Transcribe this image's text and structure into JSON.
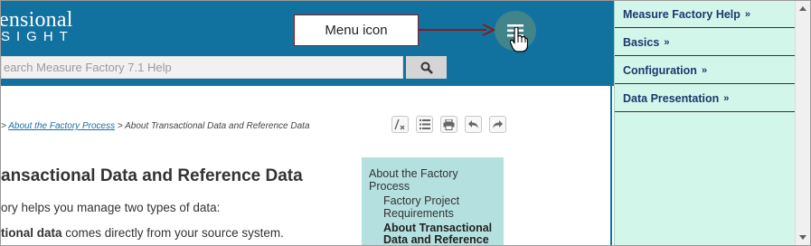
{
  "header": {
    "logo_main": "ensional",
    "logo_sub": "SIGHT",
    "search_placeholder": "earch Measure Factory 7.1 Help"
  },
  "callout": {
    "label": "Menu icon"
  },
  "breadcrumb": {
    "sep1": "> ",
    "link": "About the Factory Process",
    "sep2": " > ",
    "current": "About Transactional Data and Reference Data"
  },
  "toolbar_icons": [
    "remove-highlight-icon",
    "list-icon",
    "print-icon",
    "back-icon",
    "forward-icon"
  ],
  "article": {
    "title": "ansactional Data and Reference Data",
    "para1": "ory helps you manage two types of data:",
    "para2_bold": "tional data",
    "para2_rest": " comes directly from your source system."
  },
  "toc": {
    "parent": "About the Factory Process",
    "child1": "Factory Project Requirements",
    "child2": "About Transactional Data and Reference"
  },
  "sidenav": {
    "items": [
      {
        "label": "Measure Factory Help",
        "chevron": "»"
      },
      {
        "label": "Basics",
        "chevron": "»"
      },
      {
        "label": "Configuration",
        "chevron": "»"
      },
      {
        "label": "Data Presentation",
        "chevron": "»"
      }
    ]
  },
  "colors": {
    "header_bg": "#1172a0",
    "menu_button": "#41858b",
    "callout_border": "#8b1a1a",
    "toc_bg": "#b5e0e0",
    "sidenav_bg": "#d3f6eb",
    "nav_text": "#1a3a6e"
  }
}
